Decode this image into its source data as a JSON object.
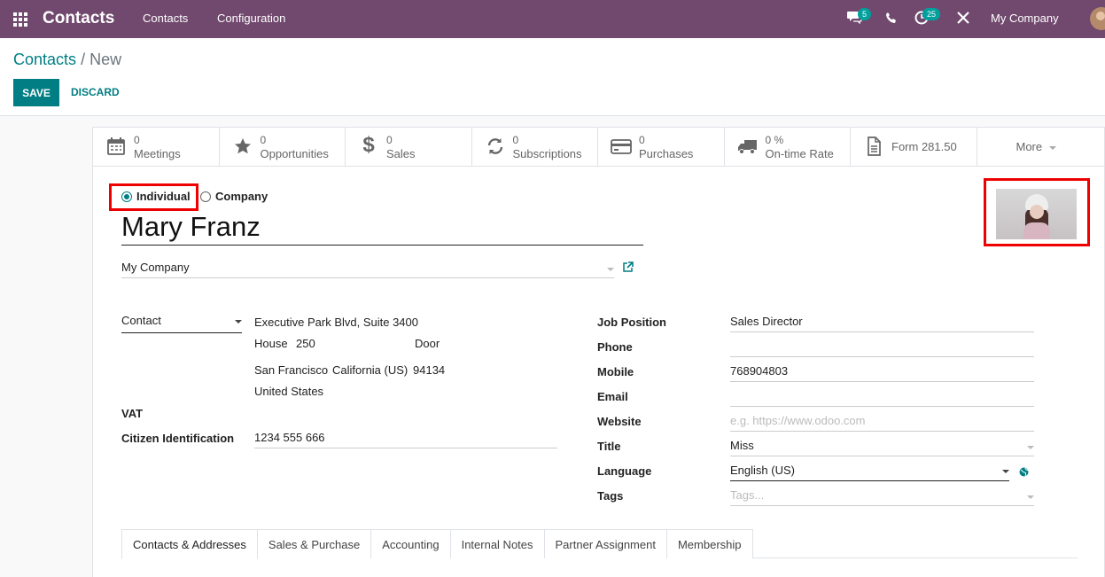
{
  "navbar": {
    "app_title": "Contacts",
    "menus": [
      "Contacts",
      "Configuration"
    ],
    "chat_badge": "5",
    "activity_badge": "25",
    "company": "My Company",
    "color": "#71496e"
  },
  "control_panel": {
    "breadcrumb_parent": "Contacts",
    "breadcrumb_sep": "/",
    "breadcrumb_current": "New",
    "save_label": "SAVE",
    "discard_label": "DISCARD"
  },
  "stat_buttons": [
    {
      "icon": "calendar-icon",
      "value": "0",
      "label": "Meetings"
    },
    {
      "icon": "star-icon",
      "value": "0",
      "label": "Opportunities"
    },
    {
      "icon": "dollar-icon",
      "value": "0",
      "label": "Sales"
    },
    {
      "icon": "refresh-icon",
      "value": "0",
      "label": "Subscriptions"
    },
    {
      "icon": "credit-card-icon",
      "value": "0",
      "label": "Purchases"
    },
    {
      "icon": "truck-icon",
      "value": "0 %",
      "label": "On-time Rate"
    },
    {
      "icon": "file-icon",
      "label": "Form 281.50"
    },
    {
      "label": "More"
    }
  ],
  "form": {
    "type_individual": "Individual",
    "type_company": "Company",
    "name": "Mary Franz",
    "company": "My Company",
    "address_type": "Contact",
    "street": "Executive Park Blvd, Suite 3400",
    "house_label": "House",
    "house_value": "250",
    "door_label": "Door",
    "city": "San Francisco",
    "state": "California (US)",
    "zip": "94134",
    "country": "United States",
    "vat_label": "VAT",
    "citizen_label": "Citizen Identification",
    "citizen_value": "1234 555 666",
    "job_position_label": "Job Position",
    "job_position_value": "Sales Director",
    "phone_label": "Phone",
    "mobile_label": "Mobile",
    "mobile_value": "768904803",
    "email_label": "Email",
    "website_label": "Website",
    "website_placeholder": "e.g. https://www.odoo.com",
    "title_label": "Title",
    "title_value": "Miss",
    "language_label": "Language",
    "language_value": "English (US)",
    "tags_label": "Tags",
    "tags_placeholder": "Tags..."
  },
  "tabs": [
    "Contacts & Addresses",
    "Sales & Purchase",
    "Accounting",
    "Internal Notes",
    "Partner Assignment",
    "Membership"
  ]
}
